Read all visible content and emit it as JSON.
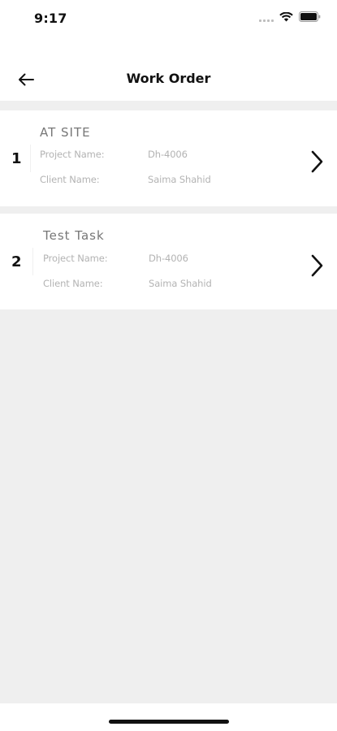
{
  "status_bar": {
    "time": "9:17",
    "icons": [
      "signal-icon",
      "wifi-icon",
      "battery-icon"
    ]
  },
  "header": {
    "title": "Work Order",
    "back_icon": "arrow-left-icon"
  },
  "work_orders": [
    {
      "index": "1",
      "title": "AT SITE",
      "project_label": "Project Name:",
      "project_value": "Dh-4006",
      "client_label": "Client Name:",
      "client_value": "Saima Shahid"
    },
    {
      "index": "2",
      "title": "Test Task",
      "project_label": "Project Name:",
      "project_value": "Dh-4006",
      "client_label": "Client Name:",
      "client_value": "Saima Shahid"
    }
  ],
  "colors": {
    "background": "#efefef",
    "card": "#ffffff",
    "text_primary": "#111111",
    "text_muted": "#b3b3b3"
  }
}
